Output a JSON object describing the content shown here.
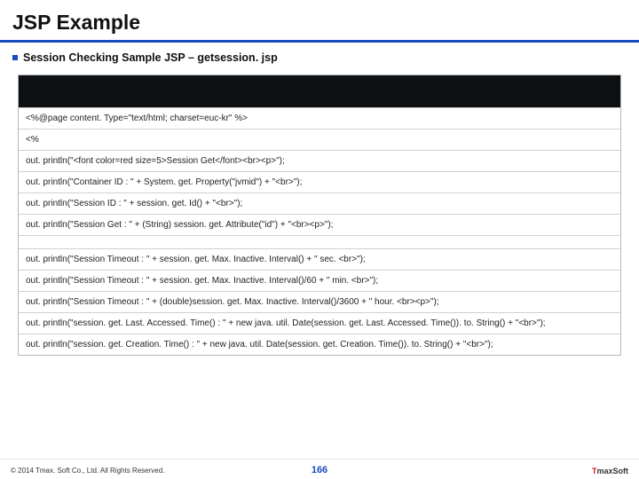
{
  "title": "JSP Example",
  "subtitle_prefix": "Session Checking Sample JSP – ",
  "subtitle_file": "getsession. jsp",
  "code_group1": [
    "<%@page content. Type=\"text/html; charset=euc-kr\" %>",
    "<%",
    "out. println(\"<font color=red size=5>Session Get</font><br><p>\");",
    "out. println(\"Container ID : \" + System. get. Property(\"jvmid\") + \"<br>\");",
    "out. println(\"Session ID : \" + session. get. Id() + \"<br>\");",
    "out. println(\"Session Get : \" + (String) session. get. Attribute(\"id\") + \"<br><p>\");"
  ],
  "code_group2": [
    "out. println(\"Session Timeout : \" + session. get. Max. Inactive. Interval() + \" sec. <br>\");",
    "out. println(\"Session Timeout : \" + session. get. Max. Inactive. Interval()/60 + \" min. <br>\");",
    "out. println(\"Session Timeout : \" + (double)session. get. Max. Inactive. Interval()/3600 + \" hour. <br><p>\");",
    "out. println(\"session. get. Last. Accessed. Time() : \" + new java. util. Date(session. get. Last. Accessed. Time()). to. String() + \"<br>\");",
    "out. println(\"session. get. Creation. Time() : \" + new java. util. Date(session. get. Creation. Time()). to. String() + \"<br>\");"
  ],
  "copyright": "© 2014 Tmax. Soft Co., Ltd. All Rights Reserved.",
  "page_number": "166",
  "logo_t": "T",
  "logo_rest": "maxSoft"
}
